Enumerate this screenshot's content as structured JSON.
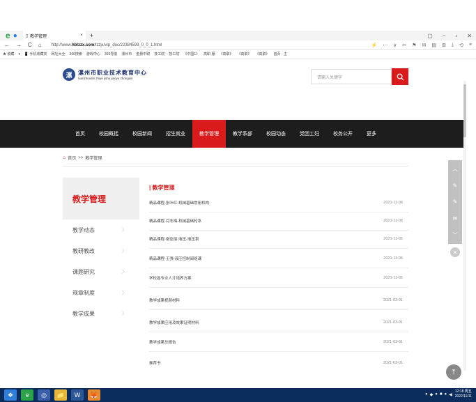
{
  "browser": {
    "tab_title": "教学管理",
    "tab_close": "×",
    "new_tab": "+",
    "url_prefix": "http://www.",
    "url_domain": "hblzzx.com",
    "url_path": "/lzzjx/vip_doc/22384599_0_0_1.html",
    "nav": [
      "←",
      "→",
      "C",
      "⌂"
    ],
    "window_controls": [
      "▢",
      "−",
      "▫",
      "✕"
    ],
    "addr_right": [
      "⚡",
      "⋯",
      "∨",
      "✂",
      "⚑",
      "✉",
      "▤",
      "⊞",
      "⤓",
      "⟲",
      "≡"
    ],
    "bookmarks": [
      "★ 收藏",
      "▾",
      "📱 手机收藏夹",
      "网址大全",
      "360搜索",
      "游戏中心",
      "360导航",
      "漯州市",
      "金爵中职",
      "技工院",
      "技工院",
      "《中国1》",
      "高职 服",
      "《高职》",
      "《高职》",
      "《高职》",
      "首页 - 主"
    ]
  },
  "site": {
    "logo_mark": "漯",
    "logo_cn": "漯州市职业技术教育中心",
    "logo_en": "luanzhoushi zhiye jishu jiaoyu zhongxin",
    "search_placeholder": "请输入关键字",
    "search_icon": "search-icon",
    "nav": [
      "首页",
      "校园概括",
      "校园新闻",
      "招生就业",
      "教学管理",
      "教学系部",
      "校园动态",
      "党团工妇",
      "校务公开",
      "更多"
    ],
    "active_nav": "教学管理",
    "accent": "#d91b1b"
  },
  "breadcrumb": {
    "home": "首页",
    "sep": ">>",
    "current": "教学管理"
  },
  "sidebar": {
    "title": "教学管理",
    "items": [
      "教学动态",
      "教研教改",
      "课题研究",
      "规章制度",
      "教学成果"
    ]
  },
  "content": {
    "title": "| 教学管理",
    "rows": [
      {
        "title": "精品课程-张叶红-机械基础常用机构",
        "date": "2021-11-06"
      },
      {
        "title": "精品课程-闫冬梅-机械基础轮系",
        "date": "2021-11-06"
      },
      {
        "title": "精品课程-谢佳丽-液压-液压泵",
        "date": "2021-11-05"
      },
      {
        "title": "精品课程-王强-液压控制阀组课",
        "date": "2021-11-05"
      },
      {
        "title": "学校各专业人才培养方案",
        "date": "2021-11-05"
      },
      {
        "title": "教学成果视频材料",
        "date": "2021-03-01"
      },
      {
        "title": "教学成果应用及效果证明材料",
        "date": "2021-03-01"
      },
      {
        "title": "教学成果总报告",
        "date": "2021-03-01"
      },
      {
        "title": "推荐书",
        "date": "2021-03-01"
      }
    ]
  },
  "side_widget": [
    "︿",
    "✎",
    "✎",
    "✉",
    "﹀"
  ],
  "side_close": "✕",
  "back_to_top": "⤒",
  "taskbar": {
    "clock_time": "12:18 周五",
    "clock_date": "2022/11/11",
    "apps": [
      "❖",
      "e",
      "◎",
      "📁",
      "W",
      "🦊"
    ]
  }
}
